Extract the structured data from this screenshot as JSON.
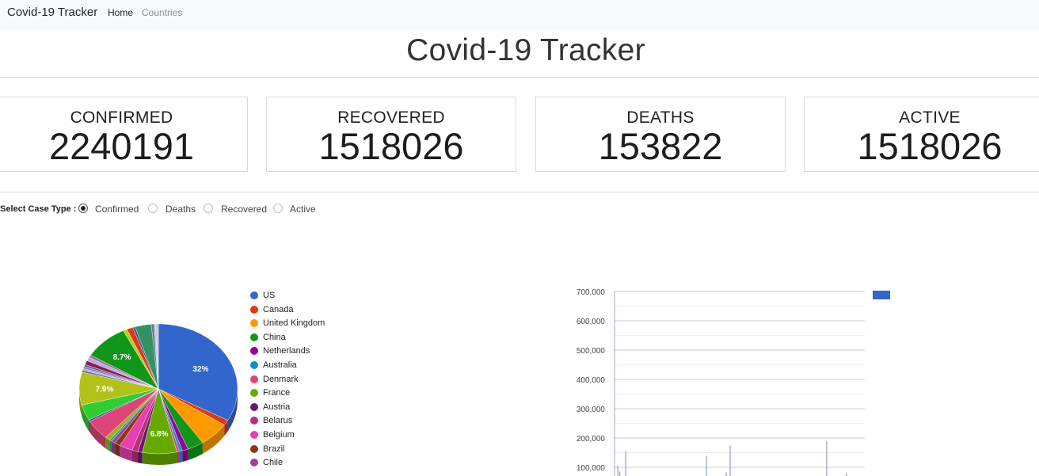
{
  "navbar": {
    "brand": "Covid-19 Tracker",
    "links": [
      {
        "label": "Home"
      },
      {
        "label": "Countries"
      }
    ]
  },
  "page": {
    "title": "Covid-19 Tracker"
  },
  "stats": [
    {
      "label": "CONFIRMED",
      "value": "2240191"
    },
    {
      "label": "RECOVERED",
      "value": "1518026"
    },
    {
      "label": "DEATHS",
      "value": "153822"
    },
    {
      "label": "ACTIVE",
      "value": "1518026"
    }
  ],
  "case_type": {
    "label": "Select Case Type :",
    "options": [
      {
        "label": "Confirmed",
        "selected": true
      },
      {
        "label": "Deaths",
        "selected": false
      },
      {
        "label": "Recovered",
        "selected": false
      },
      {
        "label": "Active",
        "selected": false
      }
    ]
  },
  "chart_data": [
    {
      "type": "pie",
      "legend": [
        {
          "name": "US",
          "color": "#3366cc"
        },
        {
          "name": "Canada",
          "color": "#dc3912"
        },
        {
          "name": "United Kingdom",
          "color": "#ff9900"
        },
        {
          "name": "China",
          "color": "#109618"
        },
        {
          "name": "Netherlands",
          "color": "#990099"
        },
        {
          "name": "Australia",
          "color": "#0099c6"
        },
        {
          "name": "Denmark",
          "color": "#dd4477"
        },
        {
          "name": "France",
          "color": "#66aa00"
        },
        {
          "name": "Austria",
          "color": "#6b1a6b"
        },
        {
          "name": "Belarus",
          "color": "#b82e7f"
        },
        {
          "name": "Belgium",
          "color": "#e83fb1"
        },
        {
          "name": "Brazil",
          "color": "#8b3a0f"
        },
        {
          "name": "Chile",
          "color": "#994499"
        }
      ],
      "slice_labels": [
        "32%",
        "8.7%",
        "7.9%",
        "6.8%"
      ],
      "slices": [
        {
          "value": 32,
          "color": "#3366cc",
          "label": "32%"
        },
        {
          "value": 1.3,
          "color": "#dc3912"
        },
        {
          "value": 6.0,
          "color": "#ff9900"
        },
        {
          "value": 3.2,
          "color": "#109618"
        },
        {
          "value": 1.2,
          "color": "#990099"
        },
        {
          "value": 0.6,
          "color": "#0099c6"
        },
        {
          "value": 0.5,
          "color": "#dd4477"
        },
        {
          "value": 6.8,
          "color": "#66aa00",
          "label": "6.8%"
        },
        {
          "value": 0.9,
          "color": "#6b1a6b"
        },
        {
          "value": 1.2,
          "color": "#b82e7f"
        },
        {
          "value": 2.6,
          "color": "#e83fb1"
        },
        {
          "value": 1.1,
          "color": "#8b3a0f"
        },
        {
          "value": 0.8,
          "color": "#994499"
        },
        {
          "value": 0.5,
          "color": "#22aa99"
        },
        {
          "value": 1.0,
          "color": "#aaaa11"
        },
        {
          "value": 4.9,
          "color": "#dd4477"
        },
        {
          "value": 0.4,
          "color": "#3b3eac"
        },
        {
          "value": 3.8,
          "color": "#33cc33"
        },
        {
          "value": 7.9,
          "color": "#b3c21a",
          "label": "7.9%"
        },
        {
          "value": 0.5,
          "color": "#6a6aa3"
        },
        {
          "value": 0.4,
          "color": "#aaaacc"
        },
        {
          "value": 0.5,
          "color": "#997799"
        },
        {
          "value": 0.5,
          "color": "#5f5fa0"
        },
        {
          "value": 1.0,
          "color": "#8a1c5a"
        },
        {
          "value": 0.9,
          "color": "#b0b0d0"
        },
        {
          "value": 0.6,
          "color": "#9d6b9d"
        },
        {
          "value": 8.7,
          "color": "#109618",
          "label": "8.7%"
        },
        {
          "value": 0.8,
          "color": "#b6cc22"
        },
        {
          "value": 1.2,
          "color": "#dc3912"
        },
        {
          "value": 0.5,
          "color": "#4e4ea0"
        },
        {
          "value": 3.2,
          "color": "#329262"
        },
        {
          "value": 0.5,
          "color": "#5574a6"
        },
        {
          "value": 0.3,
          "color": "#aaaaaa"
        },
        {
          "value": 0.6,
          "color": "#cccccc"
        }
      ]
    },
    {
      "type": "bar",
      "y_ticks": [
        "700,000",
        "600,000",
        "500,000",
        "400,000",
        "300,000",
        "200,000",
        "100,000"
      ],
      "ylim": [
        0,
        700000
      ],
      "series_color": "#3366cc",
      "values": [
        0,
        0,
        0,
        0,
        0,
        0,
        0,
        0,
        0,
        0,
        0,
        0,
        0,
        0,
        0,
        0,
        0,
        0,
        0,
        0,
        0,
        0,
        0,
        0,
        0,
        0,
        0,
        0,
        0,
        0,
        0,
        0,
        0,
        0,
        0,
        0,
        0,
        0,
        0,
        0,
        0,
        0,
        0,
        0,
        0,
        0,
        0,
        0,
        0,
        0,
        0,
        0,
        0,
        0,
        0,
        0,
        0,
        0,
        0,
        0,
        0,
        0,
        0,
        0,
        0,
        0,
        0,
        0,
        0,
        0,
        0,
        0,
        0,
        0,
        0,
        0,
        0,
        0,
        0,
        0,
        0,
        0,
        0,
        0,
        0,
        0,
        0,
        0,
        0,
        0,
        0,
        0,
        0,
        0,
        0,
        0,
        0,
        0,
        0,
        0,
        0,
        0,
        0,
        0,
        0,
        0,
        0,
        0,
        0,
        0,
        0,
        0,
        0,
        0,
        0,
        0,
        0,
        0,
        0,
        0
      ],
      "bars": [
        {
          "index": 1,
          "value": 107000
        },
        {
          "index": 2,
          "value": 85000
        },
        {
          "index": 5,
          "value": 155000
        },
        {
          "index": 46,
          "value": 140000
        },
        {
          "index": 56,
          "value": 82000
        },
        {
          "index": 58,
          "value": 174000
        },
        {
          "index": 107,
          "value": 190000
        },
        {
          "index": 117,
          "value": 80000
        }
      ],
      "bar_count": 127
    }
  ]
}
